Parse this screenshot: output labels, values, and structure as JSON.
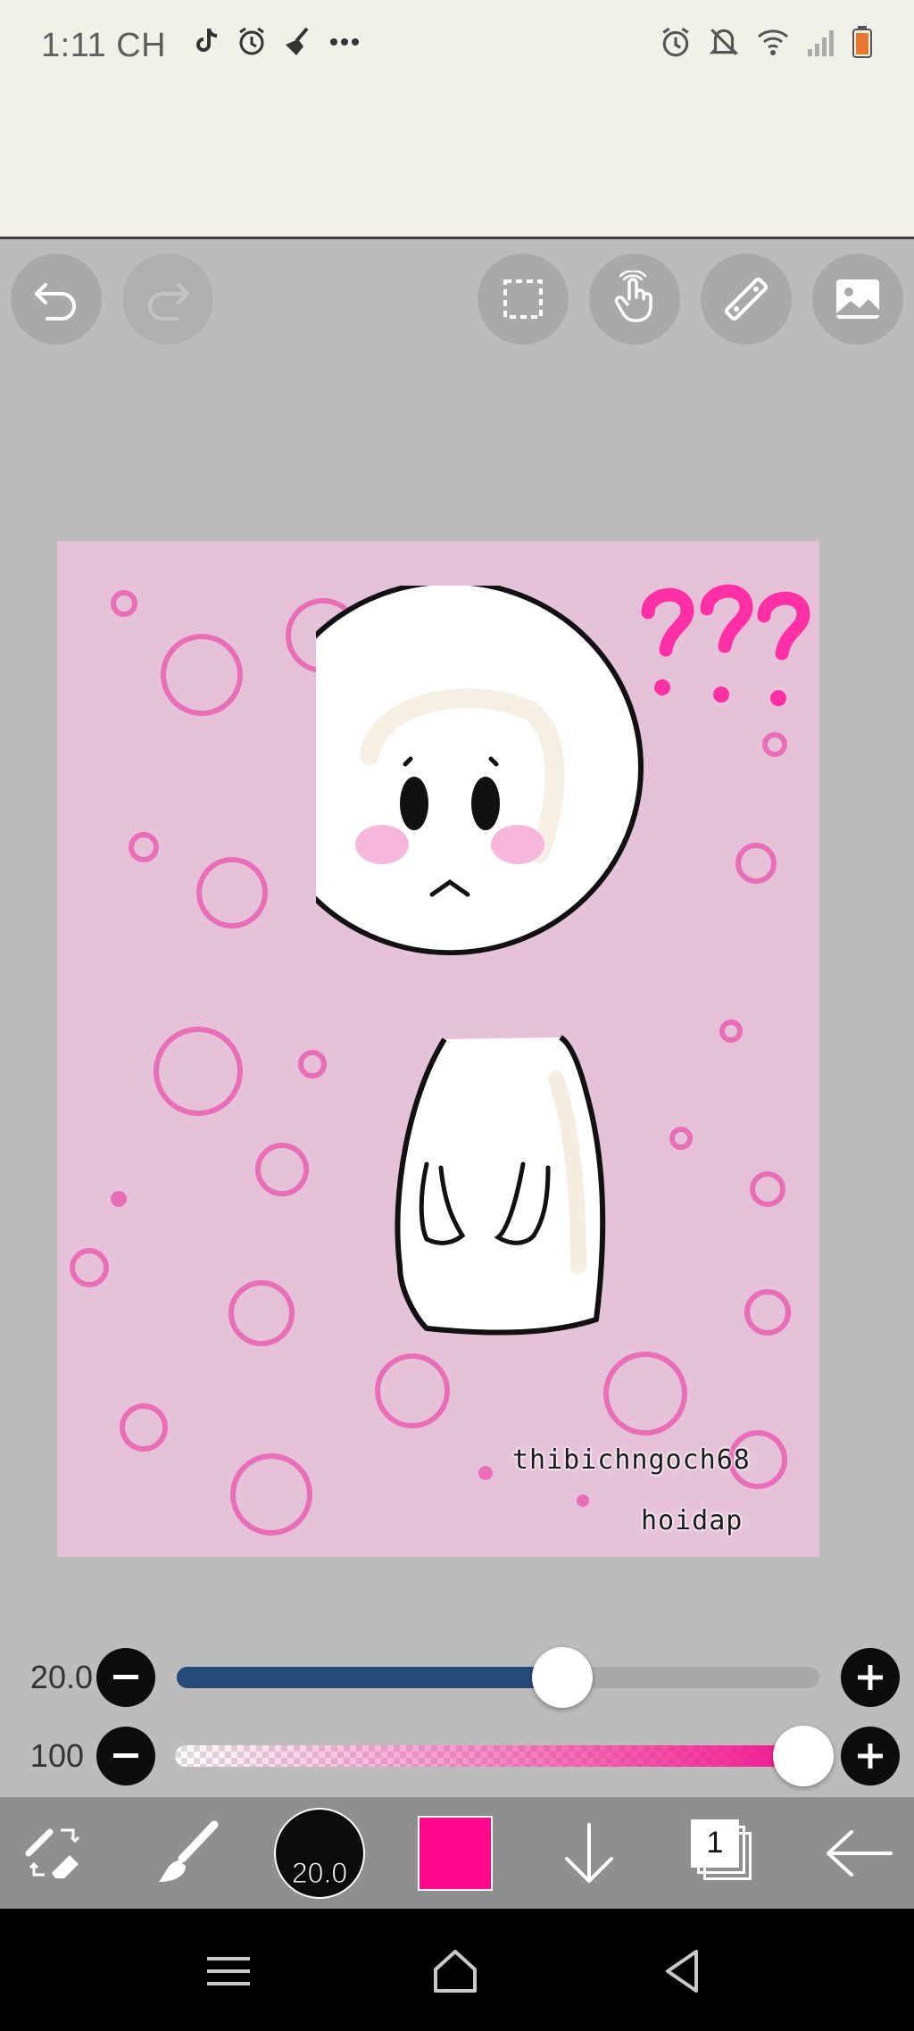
{
  "status_bar": {
    "time": "1:11 CH",
    "left_icons": [
      "tiktok-icon",
      "alarm-icon",
      "broom-icon",
      "more-dots-icon"
    ],
    "right_icons": [
      "alarm-icon",
      "mute-icon",
      "wifi-icon",
      "signal-icon",
      "battery-icon"
    ]
  },
  "top_toolbar": {
    "buttons": [
      "undo",
      "redo",
      "selection",
      "gesture",
      "ruler",
      "reference-image"
    ]
  },
  "canvas": {
    "background_color": "#e6c2d9",
    "accent_color": "#e96eb8",
    "question_marks": "???",
    "watermark_user": "thibichngoch68",
    "watermark_site": "hoidap"
  },
  "brush_size": {
    "value": "20.0",
    "level": 0.6,
    "track_color": "#254a78"
  },
  "opacity": {
    "value": "100",
    "level": 1.0,
    "track_color": "#f0148c"
  },
  "bottom_toolbar": {
    "brush_size_label": "20.0",
    "layer_count": "1",
    "current_color": "#ff0a8c"
  }
}
